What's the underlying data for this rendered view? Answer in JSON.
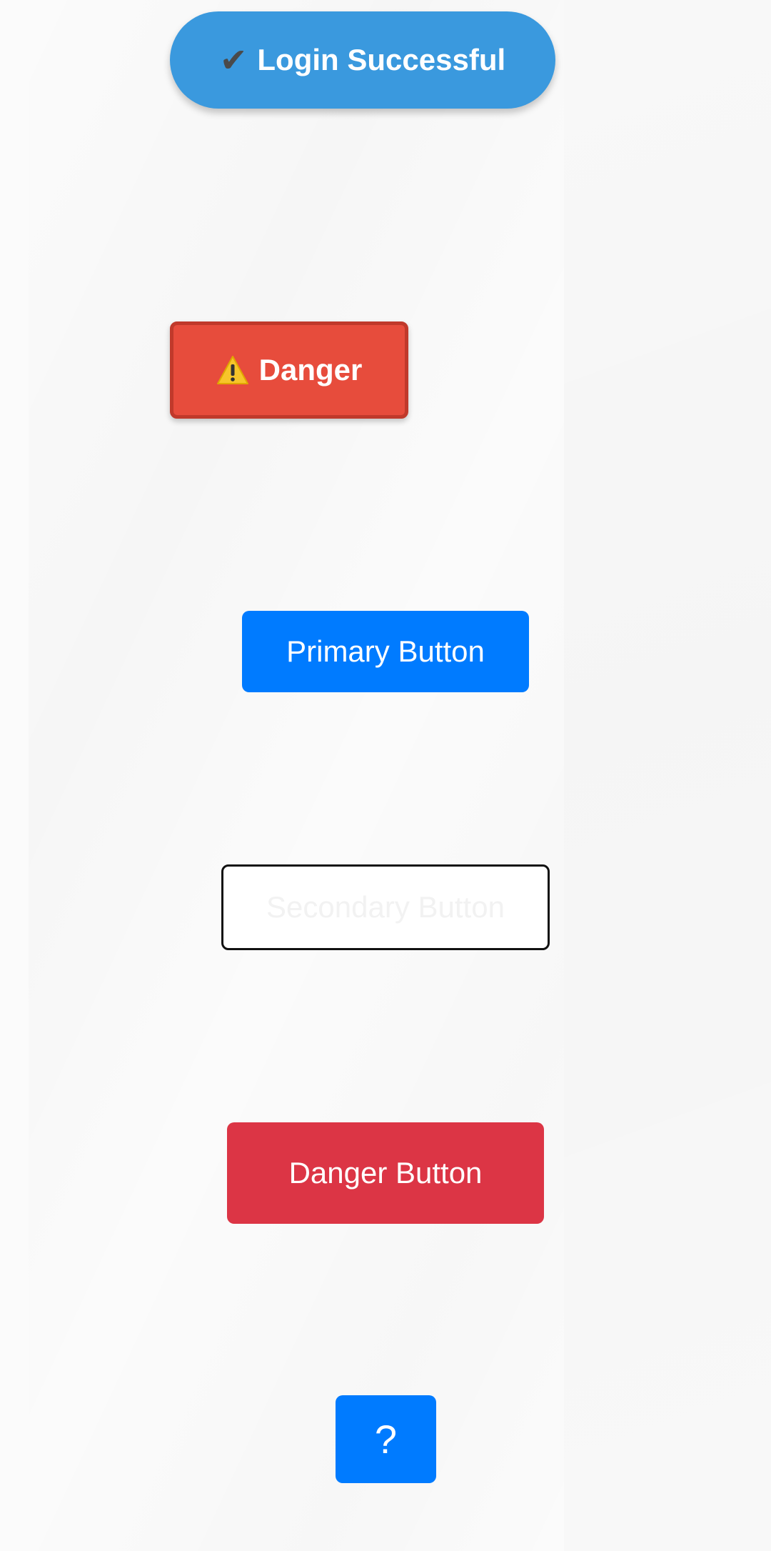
{
  "toast": {
    "icon": "check-mark-icon",
    "label": "Login Successful",
    "color": "#3a99de"
  },
  "danger_badge": {
    "icon": "warning-icon",
    "label": "Danger",
    "color": "#e74c3c",
    "border_color": "#c0392b"
  },
  "buttons": {
    "primary": {
      "label": "Primary Button",
      "color": "#007bff"
    },
    "secondary": {
      "label": "Secondary Button",
      "color": "#ffffff"
    },
    "danger": {
      "label": "Danger Button",
      "color": "#dc3545"
    },
    "help": {
      "label": "?",
      "color": "#007bff"
    }
  }
}
